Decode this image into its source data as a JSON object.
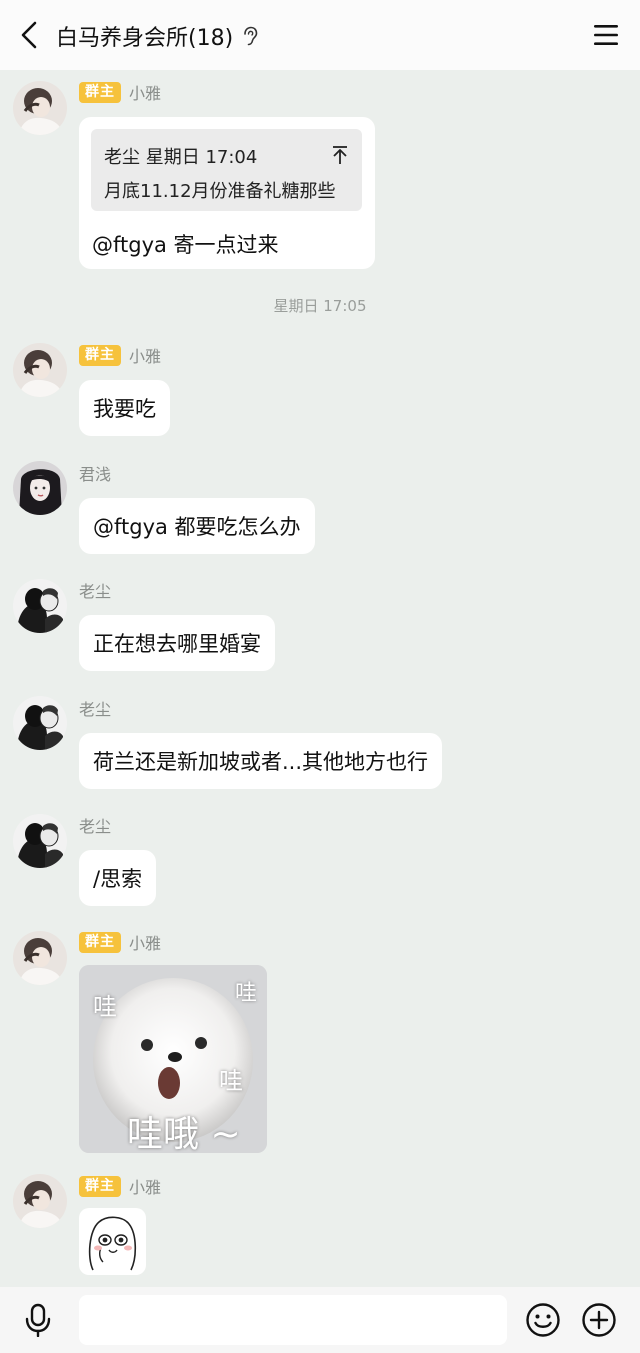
{
  "header": {
    "back_icon": "chevron-left-icon",
    "title": "白马养身会所(18)",
    "ear_icon": "ear-icon",
    "menu_icon": "hamburger-menu-icon"
  },
  "messages": [
    {
      "badge": "群主",
      "sender": "小雅",
      "quote": {
        "meta": "老尘 星期日 17:04",
        "text": "月底11.12月份准备礼糖那些"
      },
      "text": "@ftgya 寄一点过来"
    },
    {
      "badge": "群主",
      "sender": "小雅",
      "text": "我要吃"
    },
    {
      "sender": "君浅",
      "text": "@ftgya 都要吃怎么办"
    },
    {
      "sender": "老尘",
      "text": "正在想去哪里婚宴"
    },
    {
      "sender": "老尘",
      "text": "荷兰还是新加坡或者...其他地方也行"
    },
    {
      "sender": "老尘",
      "text": "/思索"
    },
    {
      "badge": "群主",
      "sender": "小雅",
      "sticker": {
        "words": [
          "哇",
          "哇",
          "哇",
          "哇哦 ~"
        ]
      }
    },
    {
      "badge": "群主",
      "sender": "小雅",
      "sticker_icon": "sticker-face-icon"
    }
  ],
  "timestamp": "星期日 17:05",
  "input_bar": {
    "voice_icon": "microphone-icon",
    "placeholder": "",
    "emoji_icon": "smiley-icon",
    "plus_icon": "plus-circle-icon"
  },
  "colors": {
    "background": "#ebefec",
    "badge": "#f6c23c",
    "bubble": "#ffffff",
    "header": "#fbfbfb"
  }
}
